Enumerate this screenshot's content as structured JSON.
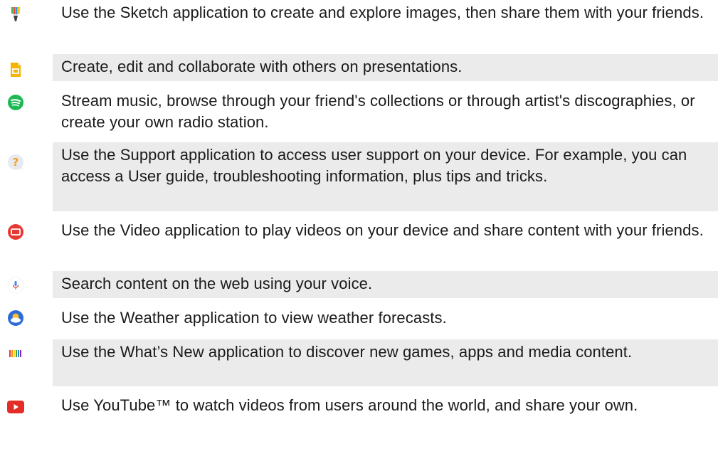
{
  "apps": [
    {
      "icon": "sketch-icon",
      "text": "Use the Sketch application to create and explore images, then share them with your friends."
    },
    {
      "icon": "slides-icon",
      "text": "Create, edit and collaborate with others on presentations."
    },
    {
      "icon": "spotify-icon",
      "text": "Stream music, browse through your friend's collections or through artist's discographies, or create your own radio station."
    },
    {
      "icon": "support-icon",
      "text": "Use the Support application to access user support on your device. For example, you can access a User guide, troubleshooting information, plus tips and tricks."
    },
    {
      "icon": "video-icon",
      "text": "Use the Video application to play videos on your device and share content with your friends."
    },
    {
      "icon": "voice-search-icon",
      "text": "Search content on the web using your voice."
    },
    {
      "icon": "weather-icon",
      "text": "Use the Weather application to view weather forecasts."
    },
    {
      "icon": "whats-new-icon",
      "text": "Use the What’s New application to discover new games, apps and media content."
    },
    {
      "icon": "youtube-icon",
      "text": "Use YouTube™ to watch videos from users around the world, and share your own."
    }
  ]
}
